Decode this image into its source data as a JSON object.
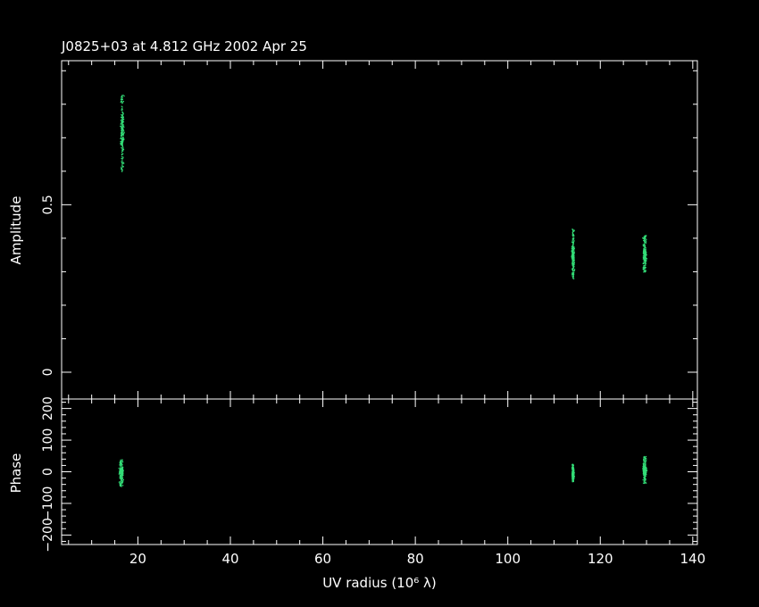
{
  "title": "J0825+03 at 4.812 GHz 2002 Apr 25",
  "colors": {
    "background": "#000000",
    "axes": "#ffffff",
    "points": "#33dd77"
  },
  "chart_data": [
    {
      "type": "scatter",
      "panel": "amplitude",
      "ylabel": "Amplitude",
      "xlim": [
        3.5,
        141
      ],
      "ylim": [
        -0.08,
        0.93
      ],
      "yticks": [
        0,
        0.5
      ],
      "ytick_labels": [
        "0",
        "0.5"
      ],
      "clusters": [
        {
          "x_center": 16.5,
          "x_spread": 0.8,
          "y_min": 0.6,
          "y_max": 0.83,
          "y_center": 0.72
        },
        {
          "x_center": 114.0,
          "x_spread": 0.6,
          "y_min": 0.28,
          "y_max": 0.43,
          "y_center": 0.35
        },
        {
          "x_center": 129.5,
          "x_spread": 0.8,
          "y_min": 0.3,
          "y_max": 0.41,
          "y_center": 0.35
        }
      ]
    },
    {
      "type": "scatter",
      "panel": "phase",
      "ylabel": "Phase",
      "xlabel": "UV radius  (10⁶ λ)",
      "xlim": [
        3.5,
        141
      ],
      "ylim": [
        -230,
        230
      ],
      "xticks": [
        20,
        40,
        60,
        80,
        100,
        120,
        140
      ],
      "xtick_labels": [
        "20",
        "40",
        "60",
        "80",
        "100",
        "120",
        "140"
      ],
      "yticks": [
        -200,
        -100,
        0,
        100,
        200
      ],
      "ytick_labels": [
        "−200",
        "−100",
        "0",
        "100",
        "200"
      ],
      "clusters": [
        {
          "x_center": 16.3,
          "x_spread": 0.9,
          "y_min": -45,
          "y_max": 40,
          "y_center": 0
        },
        {
          "x_center": 114.0,
          "x_spread": 0.5,
          "y_min": -30,
          "y_max": 25,
          "y_center": -5
        },
        {
          "x_center": 129.5,
          "x_spread": 0.8,
          "y_min": -35,
          "y_max": 50,
          "y_center": 5
        }
      ]
    }
  ]
}
